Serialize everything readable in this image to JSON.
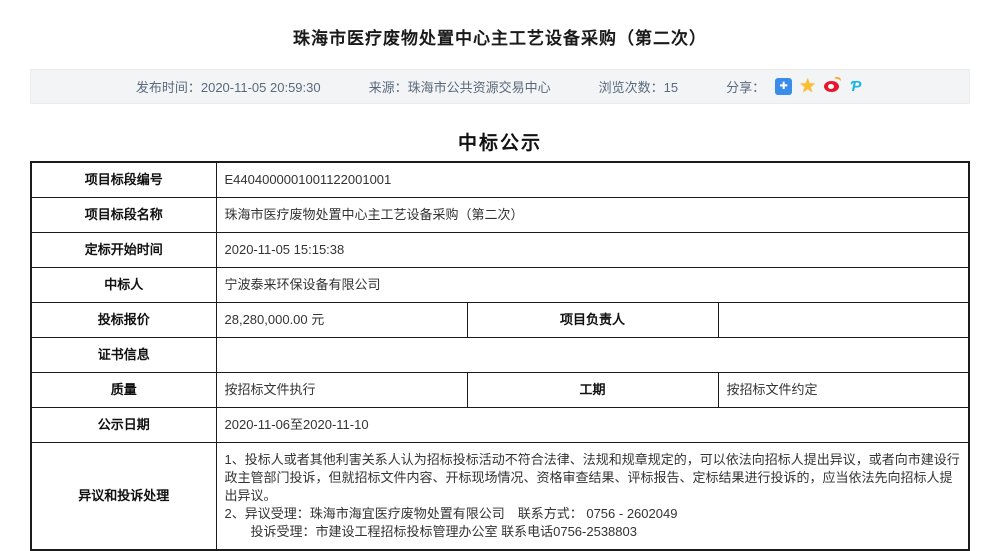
{
  "page": {
    "title": "珠海市医疗废物处置中心主工艺设备采购（第二次）",
    "section_heading": "中标公示"
  },
  "info_bar": {
    "publish_time_label": "发布时间：",
    "publish_time": "2020-11-05 20:59:30",
    "source_label": "来源：",
    "source": "珠海市公共资源交易中心",
    "views_label": "浏览次数：",
    "views": "15",
    "share_label": "分享：",
    "share_icons": [
      "share-more-icon",
      "qzone-star-icon",
      "weibo-icon",
      "tencent-weibo-icon"
    ],
    "colors": {
      "bar_background": "#f3f4f5",
      "text": "#5a6a7d",
      "share_more_blue": "#3a8ceb",
      "qzone_gold": "#fbbe2e",
      "weibo_red": "#e6162d",
      "tencent_teal": "#16b5e6"
    }
  },
  "table": {
    "rows": [
      {
        "label": "项目标段编号",
        "value": "E4404000001001122001001"
      },
      {
        "label": "项目标段名称",
        "value": "珠海市医疗废物处置中心主工艺设备采购（第二次）"
      },
      {
        "label": "定标开始时间",
        "value": "2020-11-05 15:15:38"
      },
      {
        "label": "中标人",
        "value": "宁波泰来环保设备有限公司"
      },
      {
        "label": "投标报价",
        "value": "28,280,000.00 元",
        "label2": "项目负责人",
        "value2": ""
      },
      {
        "label": "证书信息",
        "value": ""
      },
      {
        "label": "质量",
        "value": "按招标文件执行",
        "label2": "工期",
        "value2": "按招标文件约定"
      },
      {
        "label": "公示日期",
        "value": "2020-11-06至2020-11-10"
      },
      {
        "label": "异议和投诉处理"
      }
    ],
    "objection": {
      "line1": "1、投标人或者其他利害关系人认为招标投标活动不符合法律、法规和规章规定的，可以依法向招标人提出异议，或者向市建设行政主管部门投诉，但就招标文件内容、开标现场情况、资格审查结果、评标报告、定标结果进行投诉的，应当依法先向招标人提出异议。",
      "line2": "2、异议受理：珠海市海宜医疗废物处置有限公司　联系方式： 0756 - 2602049",
      "line3": "投诉受理：市建设工程招标投标管理办公室 联系电话0756-2538803"
    }
  }
}
